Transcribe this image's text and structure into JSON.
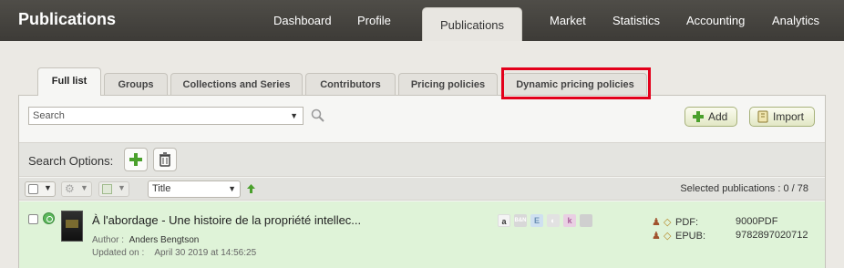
{
  "app": {
    "title": "Publications"
  },
  "nav": {
    "items": [
      {
        "label": "Dashboard"
      },
      {
        "label": "Profile"
      },
      {
        "label": "Publications",
        "active": true
      },
      {
        "label": "Market"
      },
      {
        "label": "Statistics"
      },
      {
        "label": "Accounting"
      },
      {
        "label": "Analytics"
      }
    ]
  },
  "tabs": [
    {
      "label": "Full list",
      "active": true
    },
    {
      "label": "Groups"
    },
    {
      "label": "Collections and Series"
    },
    {
      "label": "Contributors"
    },
    {
      "label": "Pricing policies"
    },
    {
      "label": "Dynamic pricing policies",
      "highlighted": true
    }
  ],
  "search": {
    "value": "Search",
    "icon": "magnifier-icon"
  },
  "actions": {
    "add_label": "Add",
    "import_label": "Import"
  },
  "search_options": {
    "label": "Search Options:"
  },
  "toolbar": {
    "sort_value": "Title",
    "selected_text": "Selected publications : 0 / 78"
  },
  "publication": {
    "title": "À l'abordage - Une histoire de la propriété intellec...",
    "author_label": "Author :",
    "author": "Anders Bengtson",
    "updated_label": "Updated on :",
    "updated": "April 30 2019 at 14:56:25",
    "stores": [
      {
        "name": "amazon",
        "glyph": "a",
        "color": "#f4f4f4",
        "text": "#333"
      },
      {
        "name": "barnes-noble",
        "glyph": "B&N",
        "color": "#d8d8d8",
        "text": "#fff"
      },
      {
        "name": "e-store",
        "glyph": "E",
        "color": "#cfe0f0",
        "text": "#6b8fb3"
      },
      {
        "name": "apple-books",
        "glyph": "◐",
        "color": "#e2e2e2",
        "text": "#fff"
      },
      {
        "name": "kobo",
        "glyph": "k",
        "color": "#e9cfe3",
        "text": "#a9609a"
      },
      {
        "name": "apple",
        "glyph": "",
        "color": "#cfcfcf",
        "text": "#fff"
      }
    ],
    "formats": [
      {
        "label": "PDF:",
        "value": "9000PDF"
      },
      {
        "label": "EPUB:",
        "value": "9782897020712"
      }
    ]
  },
  "colors": {
    "highlight": "#e3001b",
    "row_bg": "#dff3d8",
    "topbar": "#46443f"
  }
}
